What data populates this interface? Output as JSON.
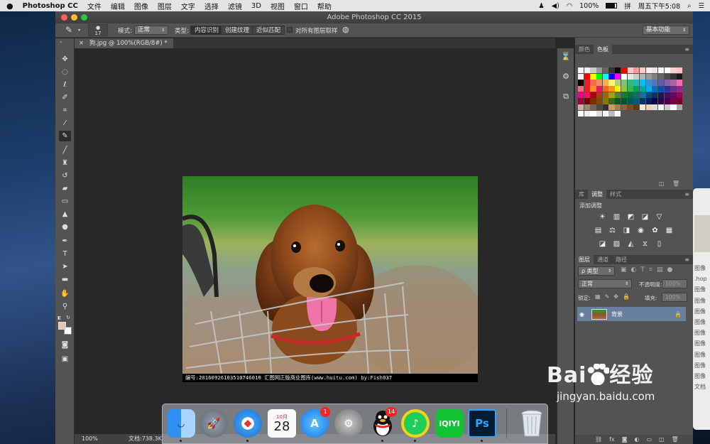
{
  "menubar": {
    "apple": "",
    "app": "Photoshop CC",
    "items": [
      "文件",
      "编辑",
      "图像",
      "图层",
      "文字",
      "选择",
      "滤镜",
      "3D",
      "视图",
      "窗口",
      "帮助"
    ],
    "battery": "100%",
    "clock": "周五下午5:08"
  },
  "window": {
    "title": "Adobe Photoshop CC 2015"
  },
  "options": {
    "brush_size": "17",
    "mode_label": "模式:",
    "mode_value": "正常",
    "type_label": "类型:",
    "types": [
      "内容识别",
      "创建纹理",
      "近似匹配"
    ],
    "sample_all": "对所有图层取样",
    "workspace": "基本功能"
  },
  "document": {
    "tab": "狗.jpg @ 100%(RGB/8#) *",
    "caption": "编号:20160926103510746010  汇图网正版商业图库(www.huitu.com) by:Fish037"
  },
  "status": {
    "zoom": "100%",
    "doc": "文档:738.3K"
  },
  "panels": {
    "color_tabs": [
      "颜色",
      "色板"
    ],
    "adj_tabs": [
      "库",
      "调整",
      "样式"
    ],
    "adj_title": "添加调整",
    "layer_tabs": [
      "图层",
      "通道",
      "路径"
    ],
    "kind": "ρ 类型",
    "blend": "正常",
    "opacity_label": "不透明度:",
    "opacity": "100%",
    "lock_label": "锁定:",
    "fill_label": "填充:",
    "fill": "100%",
    "layer_name": "背景"
  },
  "dock": {
    "apps": [
      {
        "name": "Finder"
      },
      {
        "name": "Launchpad"
      },
      {
        "name": "Safari"
      },
      {
        "name": "Calendar",
        "month": "10月",
        "day": "28"
      },
      {
        "name": "App Store",
        "badge": "1"
      },
      {
        "name": "System Preferences"
      },
      {
        "name": "QQ",
        "badge": "14"
      },
      {
        "name": "QQ Music"
      },
      {
        "name": "iQIYI",
        "label": "iQIYI"
      },
      {
        "name": "Photoshop",
        "label": "Ps"
      },
      {
        "name": "Trash"
      }
    ]
  },
  "edge_window": {
    "items": [
      "图像",
      ".hop",
      "图像",
      "图像",
      "图像",
      "图像",
      "图像",
      "图像",
      "图像",
      "图像",
      "图像",
      "文档"
    ]
  },
  "watermark": {
    "brand": "Bai",
    "brand2": "经验",
    "url": "jingyan.baidu.com"
  }
}
